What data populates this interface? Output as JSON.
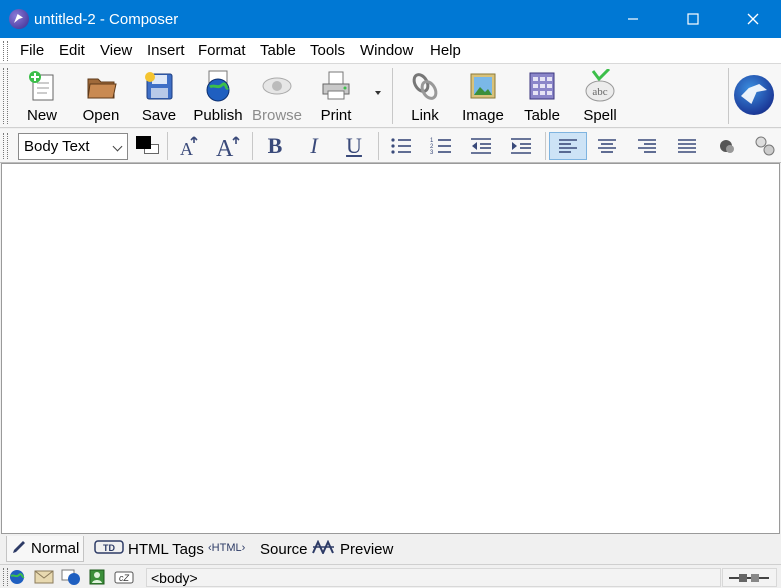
{
  "window": {
    "title": "untitled-2 - Composer",
    "controls": {
      "minimize": "minimize",
      "maximize": "maximize",
      "close": "close"
    }
  },
  "menubar": {
    "items": [
      "File",
      "Edit",
      "View",
      "Insert",
      "Format",
      "Table",
      "Tools",
      "Window",
      "Help"
    ]
  },
  "toolbar": {
    "new": "New",
    "open": "Open",
    "save": "Save",
    "publish": "Publish",
    "browse": "Browse",
    "print": "Print",
    "link": "Link",
    "image": "Image",
    "table": "Table",
    "spell": "Spell"
  },
  "formatbar": {
    "paragraph_style": "Body Text",
    "text_color": "#000000",
    "background_color": "#ffffff"
  },
  "tabs": {
    "normal": "Normal",
    "html_tags": "HTML Tags",
    "source": "Source",
    "preview": "Preview",
    "active": "normal"
  },
  "statusbar": {
    "tag_path": "<body>"
  },
  "colors": {
    "titlebar": "#0078d4",
    "active_button": "#cde3f6"
  }
}
